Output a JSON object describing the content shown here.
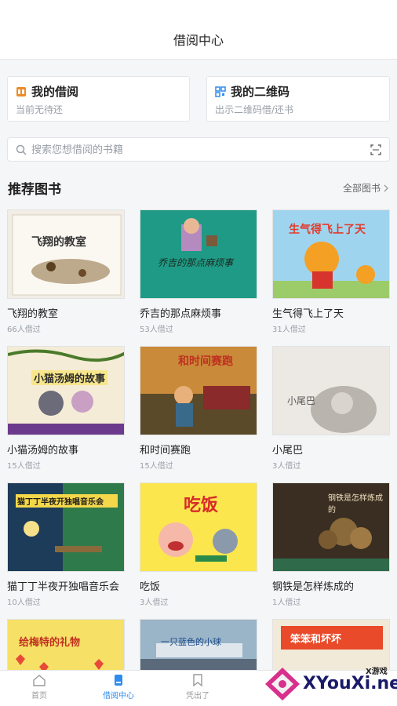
{
  "header": {
    "title": "借阅中心"
  },
  "cards": {
    "borrow": {
      "title": "我的借阅",
      "sub": "当前无待还"
    },
    "qr": {
      "title": "我的二维码",
      "sub": "出示二维码借/还书"
    }
  },
  "search": {
    "placeholder": "搜索您想借阅的书籍"
  },
  "section": {
    "title": "推荐图书",
    "more": "全部图书"
  },
  "books": [
    {
      "name": "飞翔的教室",
      "count": "66人借过",
      "cover_text": "飞翔的教室"
    },
    {
      "name": "乔吉的那点麻烦事",
      "count": "53人借过",
      "cover_text": "乔吉的那点麻烦事"
    },
    {
      "name": "生气得飞上了天",
      "count": "31人借过",
      "cover_text": "生气得飞上了天"
    },
    {
      "name": "小猫汤姆的故事",
      "count": "15人借过",
      "cover_text": "小猫汤姆的故事"
    },
    {
      "name": "和时间赛跑",
      "count": "15人借过",
      "cover_text": "和时间赛跑"
    },
    {
      "name": "小尾巴",
      "count": "3人借过",
      "cover_text": "小尾巴"
    },
    {
      "name": "猫丁丁半夜开独唱音乐会",
      "count": "10人借过",
      "cover_text": "猫丁丁半夜开独唱音乐会"
    },
    {
      "name": "吃饭",
      "count": "3人借过",
      "cover_text": "吃饭"
    },
    {
      "name": "钢铁是怎样炼成的",
      "count": "1人借过",
      "cover_text": "钢铁是怎样炼成的"
    },
    {
      "name": "",
      "count": "",
      "cover_text": "给梅特的礼物"
    },
    {
      "name": "",
      "count": "",
      "cover_text": "一只蓝色的小球"
    },
    {
      "name": "",
      "count": "",
      "cover_text": "笨笨和坏坏"
    }
  ],
  "tabs": [
    {
      "label": "首页"
    },
    {
      "label": "借阅中心"
    },
    {
      "label": "凭出了"
    }
  ],
  "watermark": {
    "brand": "XYouXi.net",
    "small": "X游戏"
  },
  "colors": {
    "accent": "#2e8bf0",
    "muted": "#9aa0a8",
    "orange": "#f08a24"
  }
}
